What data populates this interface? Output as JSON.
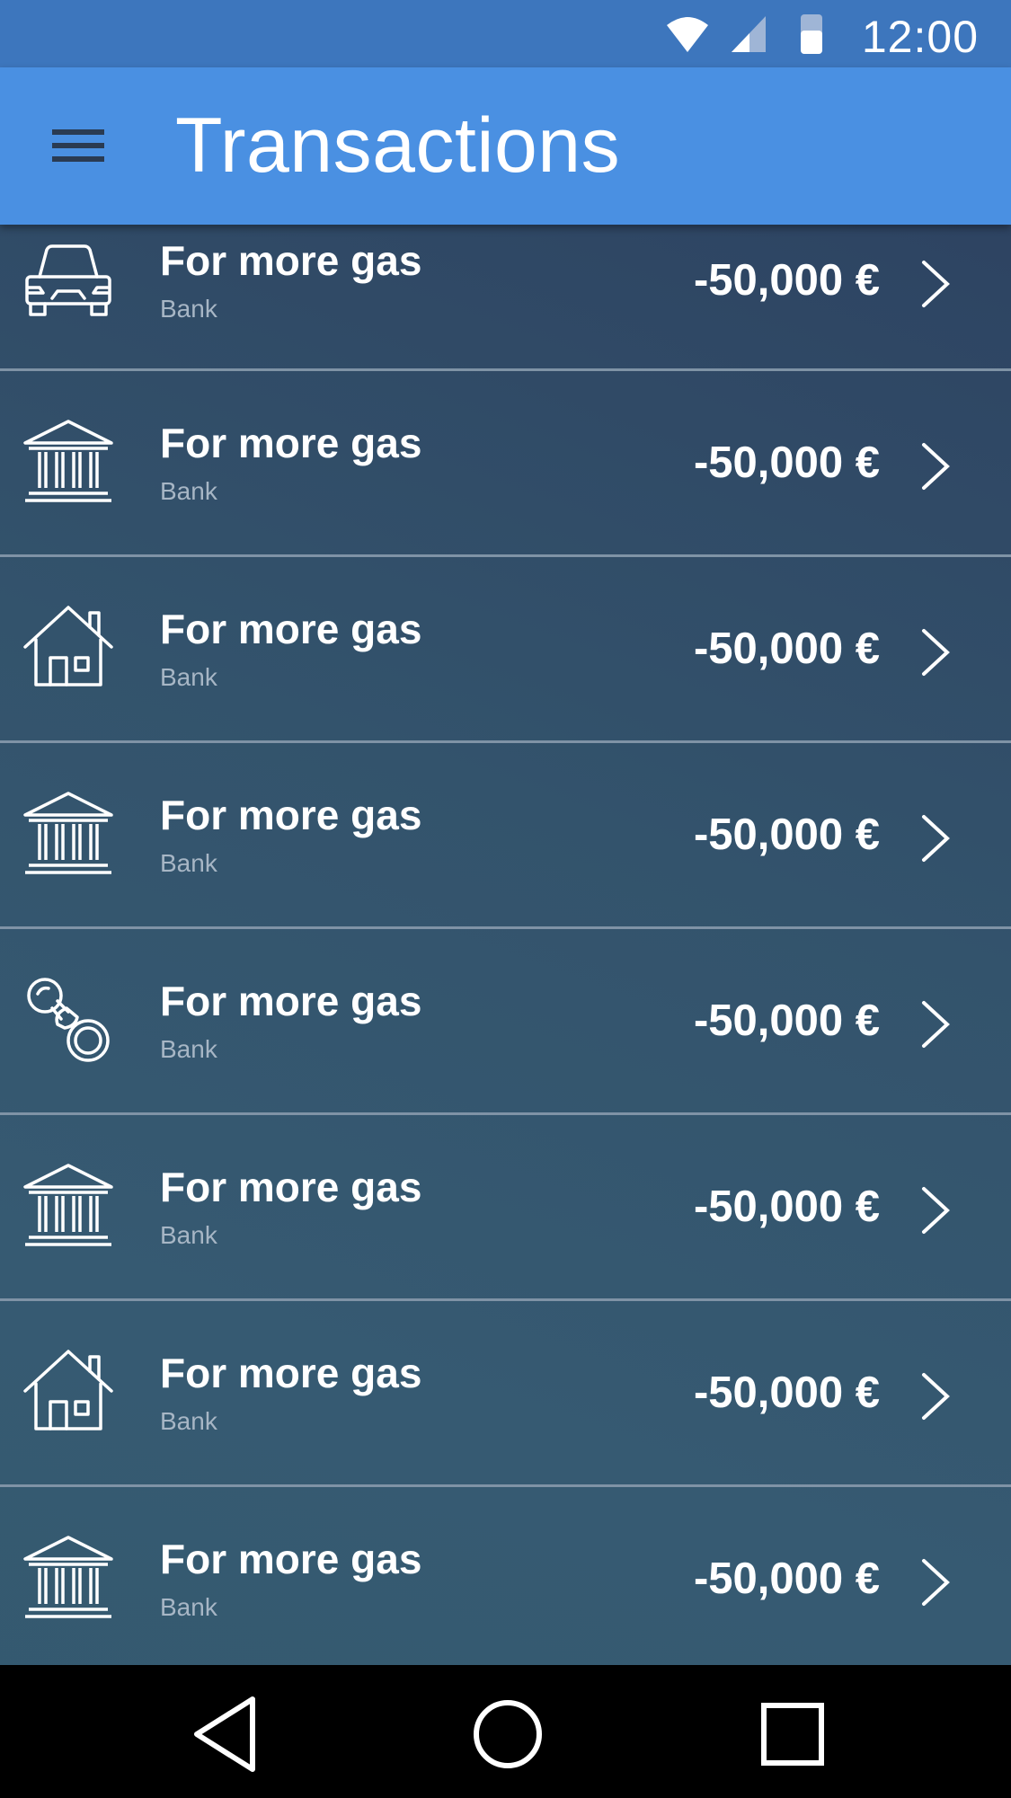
{
  "status_bar": {
    "time": "12:00",
    "icons": [
      "wifi-icon",
      "cellular-signal-icon",
      "battery-icon"
    ]
  },
  "app_bar": {
    "title": "Transactions",
    "menu_icon": "hamburger-menu-icon"
  },
  "transactions": [
    {
      "icon": "car-icon",
      "title": "For more gas",
      "subtitle": "Bank",
      "amount": "-50,000 €"
    },
    {
      "icon": "bank-icon",
      "title": "For more gas",
      "subtitle": "Bank",
      "amount": "-50,000 €"
    },
    {
      "icon": "house-icon",
      "title": "For more gas",
      "subtitle": "Bank",
      "amount": "-50,000 €"
    },
    {
      "icon": "bank-icon",
      "title": "For more gas",
      "subtitle": "Bank",
      "amount": "-50,000 €"
    },
    {
      "icon": "pacifier-icon",
      "title": "For more gas",
      "subtitle": "Bank",
      "amount": "-50,000 €"
    },
    {
      "icon": "bank-icon",
      "title": "For more gas",
      "subtitle": "Bank",
      "amount": "-50,000 €"
    },
    {
      "icon": "house-icon",
      "title": "For more gas",
      "subtitle": "Bank",
      "amount": "-50,000 €"
    },
    {
      "icon": "bank-icon",
      "title": "For more gas",
      "subtitle": "Bank",
      "amount": "-50,000 €"
    }
  ],
  "nav_bar": {
    "buttons": [
      "back-icon",
      "home-icon",
      "recents-icon"
    ]
  },
  "colors": {
    "status_bar": "#3d76bd",
    "app_bar": "#4a90e2",
    "list_background": "#34596f",
    "divider": "#7f93a6",
    "subtitle_text": "#a7b6c5"
  }
}
